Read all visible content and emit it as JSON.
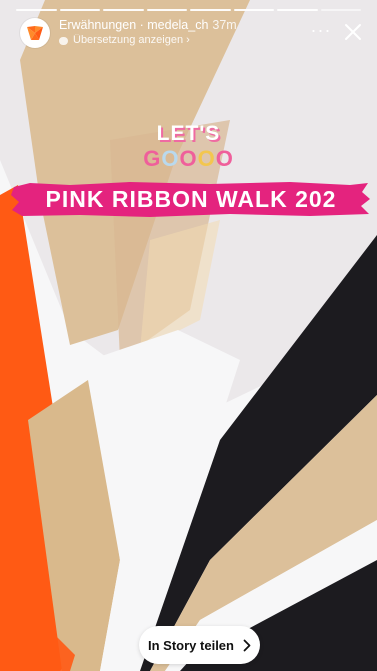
{
  "story": {
    "source_label": "Erwähnungen · medela_ch",
    "time": "37m",
    "translate_label": "Übersetzung anzeigen",
    "translate_chevron": "›",
    "more_glyph": "···",
    "progress_segments": 8,
    "progress_done": 7
  },
  "content": {
    "lets_text": "LET'S",
    "go_letters": [
      {
        "char": "G",
        "color": "#ef5f9b"
      },
      {
        "char": "O",
        "color": "#b9d9ee"
      },
      {
        "char": "O",
        "color": "#ef5f9b"
      },
      {
        "char": "O",
        "color": "#f3c64e"
      },
      {
        "char": "O",
        "color": "#ef5f9b"
      }
    ],
    "banner_text": "PINK RIBBON WALK 202",
    "banner_color": "#e4237e"
  },
  "footer": {
    "share_label": "In Story teilen"
  },
  "colors": {
    "orange": "#ff5a14",
    "wood": "#dcc09a",
    "dark": "#1c1b1f",
    "white": "#f7f7f8"
  },
  "icons": {
    "avatar": "medela-logo-icon",
    "more": "more-icon",
    "close": "close-icon",
    "share_chevron": "chevron-right-icon"
  }
}
